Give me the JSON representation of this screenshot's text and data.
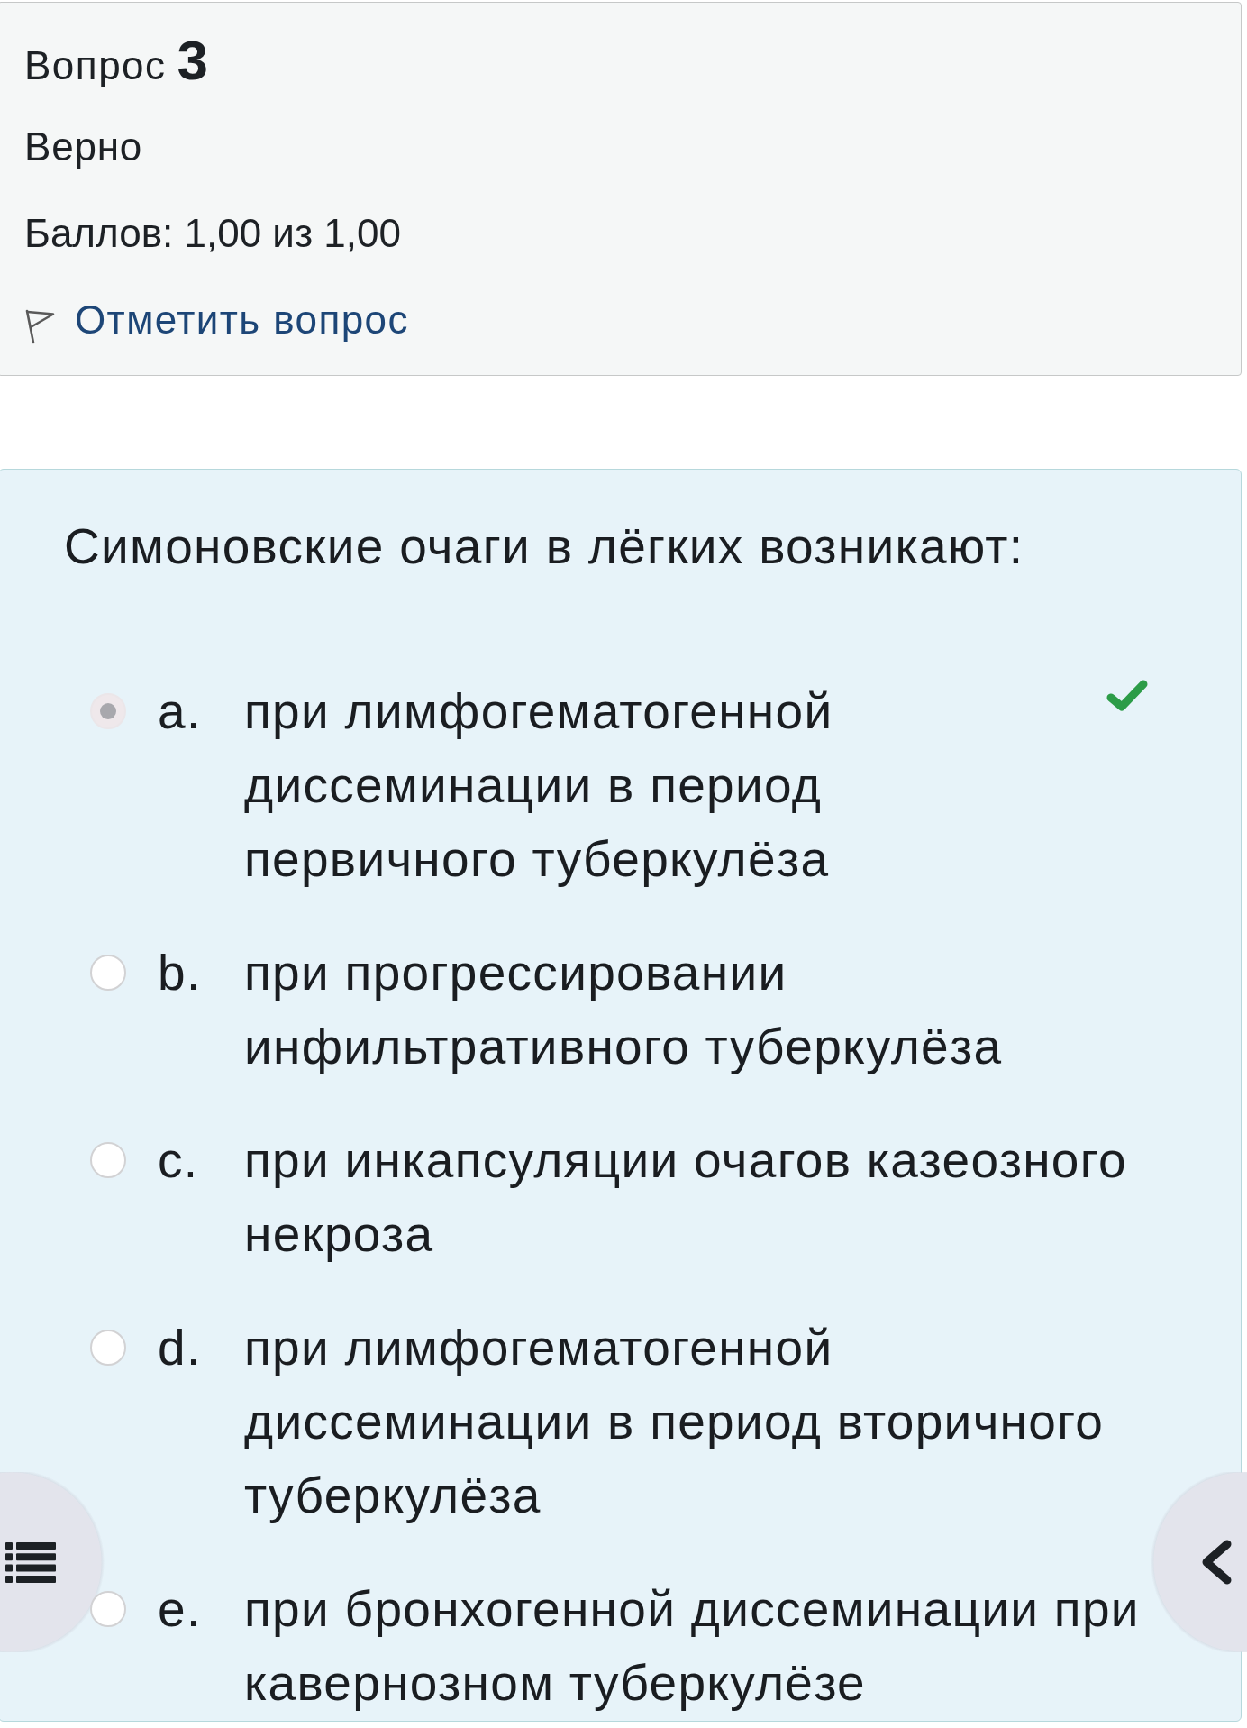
{
  "question_info": {
    "label": "Вопрос",
    "number": "3",
    "status": "Верно",
    "grade": "Баллов: 1,00 из 1,00",
    "flag_link": "Отметить вопрос"
  },
  "question": {
    "text": "Симоновские очаги в лёгких возникают:",
    "options": [
      {
        "letter": "a.",
        "text": "при лимфогематогенной диссеминации в период первичного туберкулёза",
        "selected": true,
        "correct": true
      },
      {
        "letter": "b.",
        "text": "при прогрессировании инфильтративного туберкулёза",
        "selected": false,
        "correct": false
      },
      {
        "letter": "c.",
        "text": "при инкапсуляции очагов казеозного некроза",
        "selected": false,
        "correct": false
      },
      {
        "letter": "d.",
        "text": "при лимфогематогенной диссеминации в период вторичного туберкулёза",
        "selected": false,
        "correct": false
      },
      {
        "letter": "e.",
        "text": "при бронхогенной диссеминации при кавернозном туберкулёзе",
        "selected": false,
        "correct": false
      }
    ]
  }
}
